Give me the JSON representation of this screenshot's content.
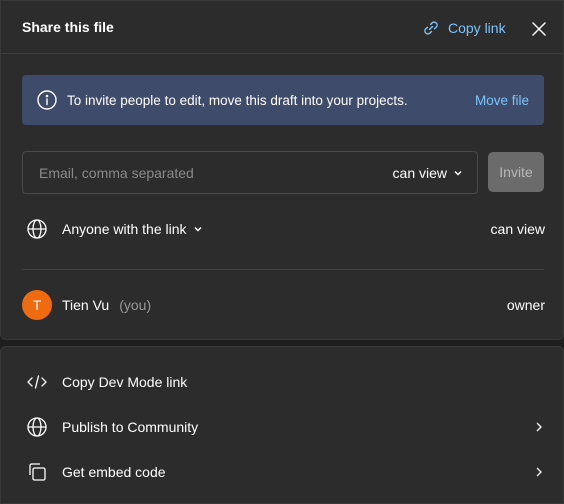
{
  "header": {
    "title": "Share this file",
    "copy_link_label": "Copy link"
  },
  "banner": {
    "text": "To invite people to edit, move this draft into your projects.",
    "action_label": "Move file"
  },
  "invite": {
    "placeholder": "Email, comma separated",
    "permission": "can view",
    "button_label": "Invite"
  },
  "link_access": {
    "label": "Anyone with the link",
    "permission": "can view"
  },
  "members": [
    {
      "avatar_initial": "T",
      "name": "Tien Vu",
      "suffix": "(you)",
      "role": "owner",
      "avatar_color": "#f06a0f"
    }
  ],
  "more_options": [
    {
      "label": "Copy Dev Mode link",
      "icon": "code-icon"
    },
    {
      "label": "Publish to Community",
      "icon": "globe-icon"
    },
    {
      "label": "Get embed code",
      "icon": "copy-icon"
    }
  ],
  "colors": {
    "accent": "#7cc4fa",
    "banner_bg": "#3f4b6b",
    "panel_bg": "#2c2c2c"
  }
}
